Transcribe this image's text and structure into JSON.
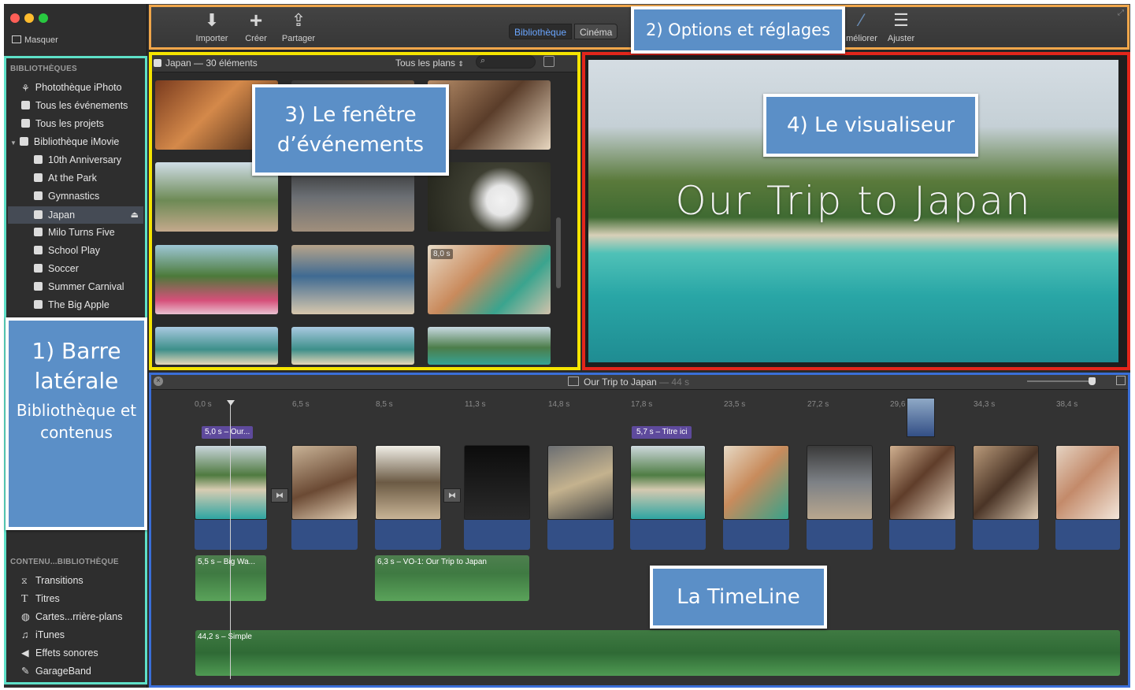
{
  "sidebar": {
    "hide_label": "Masquer",
    "libraries_header": "BIBLIOTHÈQUES",
    "libraries": [
      {
        "label": "Photothèque iPhoto"
      },
      {
        "label": "Tous les événements"
      },
      {
        "label": "Tous les projets"
      },
      {
        "label": "Bibliothèque iMovie"
      }
    ],
    "events": [
      {
        "label": "10th Anniversary"
      },
      {
        "label": "At the Park"
      },
      {
        "label": "Gymnastics"
      },
      {
        "label": "Japan"
      },
      {
        "label": "Milo Turns Five"
      },
      {
        "label": "School Play"
      },
      {
        "label": "Soccer"
      },
      {
        "label": "Summer Carnival"
      },
      {
        "label": "The Big Apple"
      }
    ],
    "content_header": "CONTENU...BIBLIOTHÈQUE",
    "content": [
      {
        "label": "Transitions"
      },
      {
        "label": "Titres"
      },
      {
        "label": "Cartes...rrière-plans"
      },
      {
        "label": "iTunes"
      },
      {
        "label": "Effets sonores"
      },
      {
        "label": "GarageBand"
      }
    ]
  },
  "toolbar": {
    "import": "Importer",
    "create": "Créer",
    "share": "Partager",
    "tab_library": "Bibliothèque",
    "tab_cinema": "Cinéma",
    "enhance": "méliorer",
    "adjust": "Ajuster"
  },
  "events_browser": {
    "title": "Japan — 30 éléments",
    "filter": "Tous les plans",
    "badge": "8,0 s"
  },
  "viewer": {
    "title_text": "Our Trip to Japan"
  },
  "timeline": {
    "project": "Our Trip to Japan",
    "duration": "— 44 s",
    "ticks": [
      "0,0 s",
      "6,5 s",
      "8,5 s",
      "11,3 s",
      "14,8 s",
      "17,8 s",
      "23,5 s",
      "27,2 s",
      "29,6",
      "34,3 s",
      "38,4 s"
    ],
    "title1": "5,0 s – Our...",
    "title2": "5,7 s – Titre ici",
    "audio1": "5,5 s – Big Wa...",
    "audio2": "6,3 s – VO-1: Our Trip to Japan",
    "music": "44,2 s – Simple"
  },
  "callouts": {
    "c1_title": "1) Barre latérale",
    "c1_sub": "Bibliothèque et contenus",
    "c2": "2) Options et réglages",
    "c3": "3) Le fenêtre d’événements",
    "c4": "4) Le visualiseur",
    "c5": "La TimeLine"
  },
  "colors": {
    "sidebar_frame": "#5ee0c8",
    "toolbar_frame": "#f0a64a",
    "events_frame": "#f5e400",
    "viewer_frame": "#e3261b",
    "timeline_frame": "#3a6fd8",
    "callout_bg": "#5b8fc7"
  }
}
